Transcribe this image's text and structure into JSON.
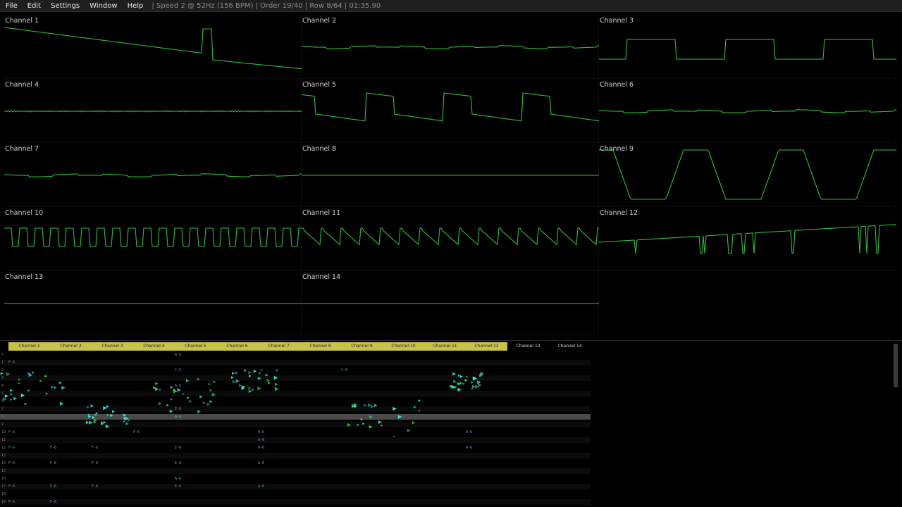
{
  "menubar": {
    "items": [
      "File",
      "Edit",
      "Settings",
      "Window",
      "Help"
    ],
    "status": "| Speed 2 @ 52Hz (156 BPM) | Order 19/40 | Row 8/64 | 01:35.90"
  },
  "oscilloscopes": [
    {
      "label": "Channel 1",
      "wave": "ramp-spike"
    },
    {
      "label": "Channel 2",
      "wave": "flat-wobble"
    },
    {
      "label": "Channel 3",
      "wave": "square"
    },
    {
      "label": "Channel 4",
      "wave": "noise-flat"
    },
    {
      "label": "Channel 5",
      "wave": "saw-square"
    },
    {
      "label": "Channel 6",
      "wave": "flat-wobble"
    },
    {
      "label": "Channel 7",
      "wave": "flat-wobble"
    },
    {
      "label": "Channel 8",
      "wave": "flat"
    },
    {
      "label": "Channel 9",
      "wave": "trapezoid"
    },
    {
      "label": "Channel 10",
      "wave": "pulse-fast"
    },
    {
      "label": "Channel 11",
      "wave": "saw-fast"
    },
    {
      "label": "Channel 12",
      "wave": "spiky-ramp"
    },
    {
      "label": "Channel 13",
      "wave": "flat"
    },
    {
      "label": "Channel 14",
      "wave": "flat"
    }
  ],
  "pattern": {
    "channels": [
      "Channel 1",
      "Channel 2",
      "Channel 3",
      "Channel 4",
      "Channel 5",
      "Channel 6",
      "Channel 7",
      "Channel 8",
      "Channel 9",
      "Channel 10",
      "Channel 11",
      "Channel 12",
      "Channel 13",
      "Channel 14"
    ],
    "highlighted_channels": 12,
    "current_row": 8,
    "rows": [
      [
        "0",
        "",
        "",
        "",
        "",
        "A-6",
        "",
        "",
        "",
        "",
        "",
        "",
        "",
        ""
      ],
      [
        "1",
        "F-6",
        "",
        "",
        "",
        "",
        "",
        "",
        "",
        "",
        "",
        "",
        "",
        ""
      ],
      [
        "2",
        "",
        "",
        "",
        "",
        "C-5",
        "",
        "",
        "",
        "C-6",
        "",
        "",
        "",
        ""
      ],
      [
        "3",
        "",
        "",
        "",
        "",
        "",
        "",
        "",
        "",
        "",
        "",
        "",
        "",
        ""
      ],
      [
        "4",
        "",
        "",
        "",
        "",
        "A-6",
        "",
        "",
        "",
        "",
        "",
        "",
        "",
        ""
      ],
      [
        "5",
        "",
        "",
        "",
        "",
        "",
        "",
        "",
        "",
        "",
        "",
        "",
        "",
        ""
      ],
      [
        "6",
        "",
        "",
        "",
        "",
        "",
        "",
        "",
        "",
        "",
        "",
        "",
        "",
        ""
      ],
      [
        "7",
        "",
        "",
        "",
        "",
        "E-6",
        "",
        "",
        "",
        "",
        "",
        "",
        "",
        ""
      ],
      [
        "8",
        "",
        "",
        "",
        "",
        "A-6",
        "",
        "",
        "",
        "",
        "",
        "",
        "",
        ""
      ],
      [
        "9",
        "",
        "",
        "",
        "",
        "",
        "",
        "",
        "",
        "",
        "",
        "",
        "",
        ""
      ],
      [
        "10",
        "F-6",
        "",
        "",
        "F-6",
        "",
        "",
        "E-6",
        "",
        "",
        "",
        "",
        "A-6",
        ""
      ],
      [
        "11",
        "",
        "",
        "",
        "",
        "",
        "",
        "A-6",
        "",
        "",
        "",
        "",
        "",
        ""
      ],
      [
        "12",
        "F-6",
        "F-6",
        "F-6",
        "",
        "E-6",
        "",
        "A-6",
        "",
        "",
        "",
        "",
        "A-6",
        ""
      ],
      [
        "13",
        "",
        "",
        "",
        "",
        "",
        "",
        "",
        "",
        "",
        "",
        "",
        "",
        ""
      ],
      [
        "14",
        "F-6",
        "F-6",
        "F-6",
        "",
        "E-6",
        "",
        "A-6",
        "",
        "",
        "",
        "",
        "",
        ""
      ],
      [
        "15",
        "",
        "",
        "",
        "",
        "",
        "",
        "",
        "",
        "",
        "",
        "",
        "",
        ""
      ],
      [
        "16",
        "",
        "",
        "",
        "",
        "A-6",
        "",
        "",
        "",
        "",
        "",
        "",
        "",
        ""
      ],
      [
        "17",
        "F-6",
        "F-6",
        "F-6",
        "",
        "E-6",
        "",
        "A-6",
        "",
        "",
        "",
        "",
        "",
        ""
      ],
      [
        "18",
        "",
        "",
        "",
        "",
        "",
        "",
        "",
        "",
        "",
        "",
        "",
        "",
        ""
      ],
      [
        "19",
        "F-6",
        "F-6",
        "",
        "",
        "",
        "",
        "",
        "",
        "",
        "",
        "",
        "",
        ""
      ]
    ]
  },
  "colors": {
    "wave": "#2fbf3a",
    "header_highlight": "#c9c24a",
    "particle_cyan": "#3ff0e0",
    "particle_green": "#4fd84f"
  }
}
